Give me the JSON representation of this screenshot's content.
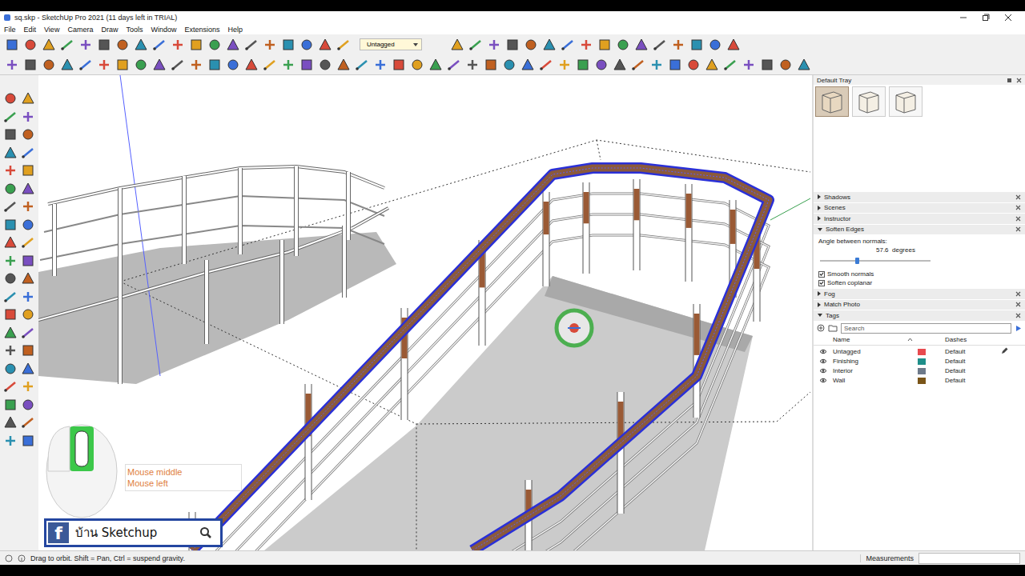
{
  "window": {
    "title": "sq.skp - SketchUp Pro 2021 (11 days left in TRIAL)"
  },
  "menu": [
    "File",
    "Edit",
    "View",
    "Camera",
    "Draw",
    "Tools",
    "Window",
    "Extensions",
    "Help"
  ],
  "toolbar": {
    "tag_dropdown": "Untagged"
  },
  "viewport": {
    "overlay": {
      "mouse_middle_pressed": true,
      "mouse_left_pressed": false,
      "labels": [
        "Mouse middle",
        "Mouse left"
      ],
      "badge": {
        "logo": "f",
        "text": "บ้าน Sketchup"
      }
    }
  },
  "tray": {
    "title": "Default Tray",
    "styles": [
      {
        "selected": true
      },
      {
        "selected": false
      },
      {
        "selected": false
      }
    ],
    "panels": [
      {
        "title": "Shadows",
        "expanded": false,
        "kind": "plain"
      },
      {
        "title": "Scenes",
        "expanded": false,
        "kind": "plain"
      },
      {
        "title": "Instructor",
        "expanded": false,
        "kind": "plain"
      },
      {
        "title": "Soften Edges",
        "expanded": true,
        "kind": "soften"
      },
      {
        "title": "Fog",
        "expanded": false,
        "kind": "plain"
      },
      {
        "title": "Match Photo",
        "expanded": false,
        "kind": "plain"
      },
      {
        "title": "Tags",
        "expanded": true,
        "kind": "tags"
      }
    ],
    "soften_edges": {
      "angle_label": "Angle between normals:",
      "angle_value": "57.6",
      "angle_unit": "degrees",
      "level": 0.33,
      "options": [
        {
          "label": "Smooth normals",
          "checked": true
        },
        {
          "label": "Soften coplanar",
          "checked": true
        }
      ]
    },
    "tags": {
      "search_placeholder": "Search",
      "columns": [
        "Name",
        "Dashes"
      ],
      "rows": [
        {
          "name": "Untagged",
          "visible": true,
          "color": "#e84a4f",
          "dashes": "Default",
          "active": true
        },
        {
          "name": "Finishing",
          "visible": true,
          "color": "#1f8f8a",
          "dashes": "Default",
          "active": false
        },
        {
          "name": "Interior",
          "visible": true,
          "color": "#6e7a8a",
          "dashes": "Default",
          "active": false
        },
        {
          "name": "Wall",
          "visible": true,
          "color": "#7a5518",
          "dashes": "Default",
          "active": false
        }
      ]
    }
  },
  "status_bar": {
    "hint": "Drag to orbit. Shift = Pan, Ctrl = suspend gravity.",
    "measurements_label": "Measurements",
    "measurements_value": ""
  }
}
